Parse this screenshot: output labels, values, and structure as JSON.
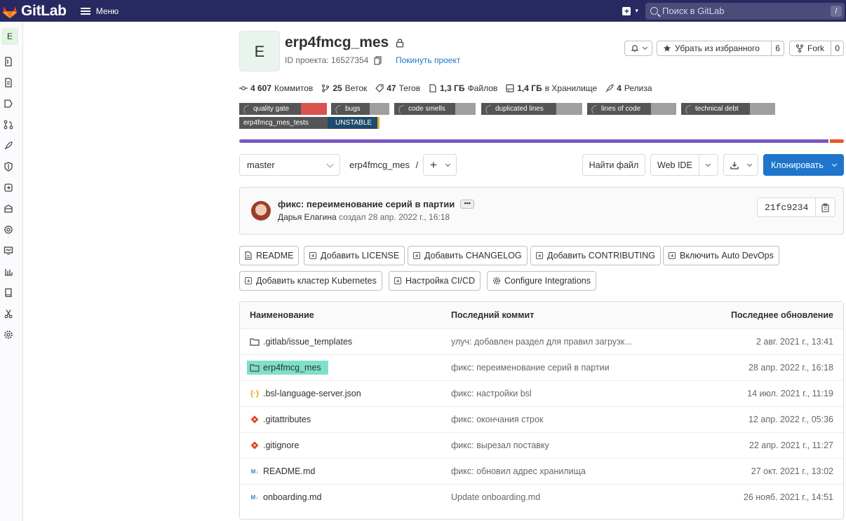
{
  "navbar": {
    "brand": "GitLab",
    "menu_label": "Меню",
    "search_placeholder": "Поиск в GitLab",
    "search_kbd": "/"
  },
  "sidebar": {
    "project_letter": "E"
  },
  "project": {
    "letter": "E",
    "name": "erp4fmcg_mes",
    "id_label": "ID проекта: 16527354",
    "leave_label": "Покинуть проект",
    "star_label": "Убрать из избранного",
    "star_count": "6",
    "fork_label": "Fork",
    "fork_count": "0"
  },
  "stats": [
    {
      "num": "4 607",
      "label": "Коммитов"
    },
    {
      "num": "25",
      "label": "Веток"
    },
    {
      "num": "47",
      "label": "Тегов"
    },
    {
      "num": "1,3 ГБ",
      "label": "Файлов"
    },
    {
      "num": "1,4 ГБ",
      "label": "в Хранилище"
    },
    {
      "num": "4",
      "label": "Релиза"
    }
  ],
  "badges": {
    "quality_gate": "quality gate",
    "bugs": "bugs",
    "code_smells": "code smells",
    "duplicated_lines": "duplicated lines",
    "lines_of_code": "lines of code",
    "technical_debt": "technical debt",
    "tests_label": "erp4fmcg_mes_tests",
    "tests_status": "UNSTABLE",
    "colors": {
      "quality_gate": "#d9534f",
      "status": "#1e4b6b"
    }
  },
  "language_bar": {
    "primary_color": "#7e57c2",
    "secondary_color": "#e8562a",
    "primary_fraction": 0.975
  },
  "branch": {
    "selected": "master",
    "path": "erp4fmcg_mes",
    "path_sep": "/",
    "find_file": "Найти файл",
    "web_ide": "Web IDE",
    "clone": "Клонировать"
  },
  "last_commit": {
    "title": "фикс: переименование серий в партии",
    "more": "•••",
    "author": "Дарья Елагина",
    "created": "создал 28 апр. 2022 г., 16:18",
    "sha": "21fc9234"
  },
  "quick_actions": [
    "README",
    "Добавить LICENSE",
    "Добавить CHANGELOG",
    "Добавить CONTRIBUTING",
    "Включить Auto DevOps",
    "Добавить кластер Kubernetes",
    "Настройка CI/CD",
    "Configure Integrations"
  ],
  "files": {
    "headers": {
      "name": "Наименование",
      "commit": "Последний коммит",
      "date": "Последнее обновление"
    },
    "rows": [
      {
        "name": ".gitlab/issue_templates",
        "commit": "улуч: добавлен раздел для правил загрузк...",
        "date": "2 авг. 2021 г., 13:41"
      },
      {
        "name": "erp4fmcg_mes",
        "commit": "фикс: переименование серий в партии",
        "date": "28 апр. 2022 г., 16:18"
      },
      {
        "name": ".bsl-language-server.json",
        "commit": "фикс: настройки bsl",
        "date": "14 июл. 2021 г., 11:19"
      },
      {
        "name": ".gitattributes",
        "commit": "фикс: окончания строк",
        "date": "12 апр. 2022 г., 05:36"
      },
      {
        "name": ".gitignore",
        "commit": "фикс: вырезал поставку",
        "date": "22 апр. 2021 г., 11:27"
      },
      {
        "name": "README.md",
        "commit": "фикс: обновил адрес хранилища",
        "date": "27 окт. 2021 г., 13:02"
      },
      {
        "name": "onboarding.md",
        "commit": "Update onboarding.md",
        "date": "26 нояб. 2021 г., 14:51"
      }
    ]
  }
}
